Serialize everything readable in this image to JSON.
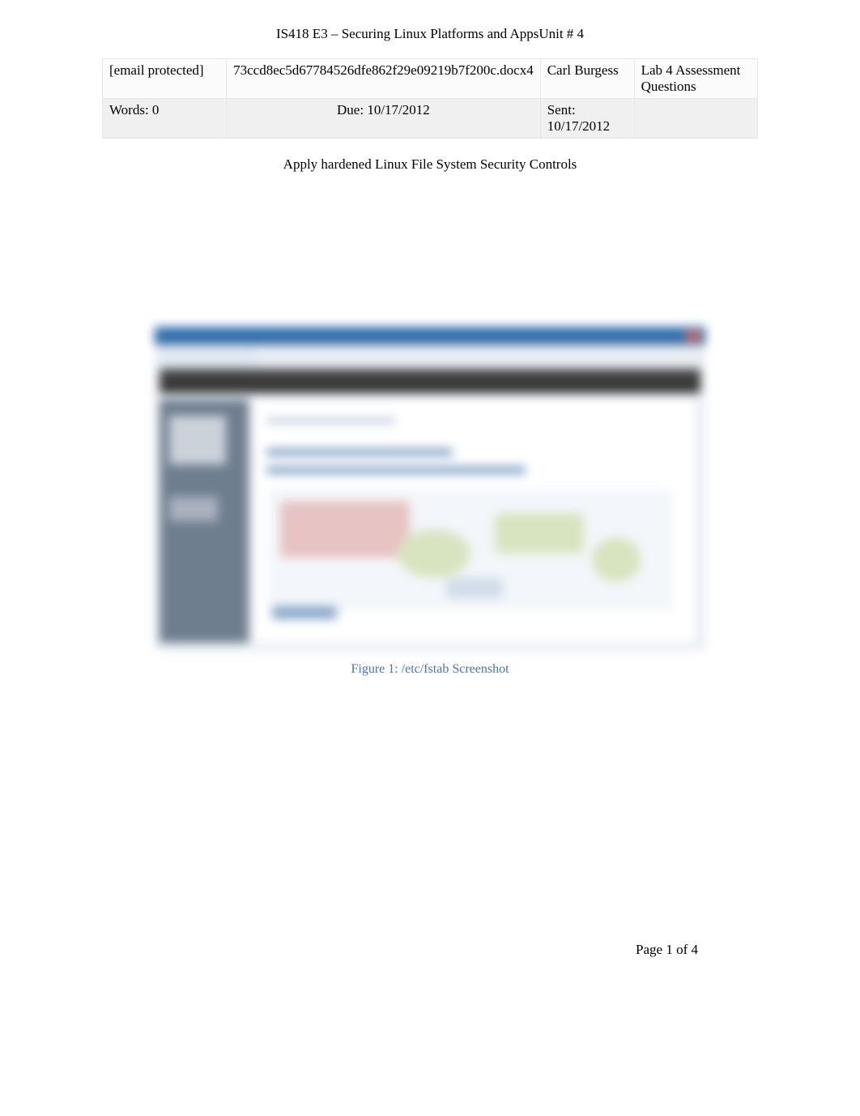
{
  "header": {
    "title": "IS418 E3 – Securing Linux Platforms and AppsUnit # 4"
  },
  "info": {
    "email": "[email protected]",
    "filename": "73ccd8ec5d67784526dfe862f29e09219b7f200c.docx4",
    "student": "Carl Burgess",
    "doc_title": "Lab 4 Assessment Questions",
    "words_label": "Words: 0",
    "due_label": "Due: 10/17/2012",
    "sent_label": "Sent: 10/17/2012"
  },
  "subtitle": "Apply hardened Linux File System Security Controls",
  "figure": {
    "caption": "Figure 1: /etc/fstab Screenshot"
  },
  "footer": {
    "page_label": "Page 1 of 4"
  }
}
